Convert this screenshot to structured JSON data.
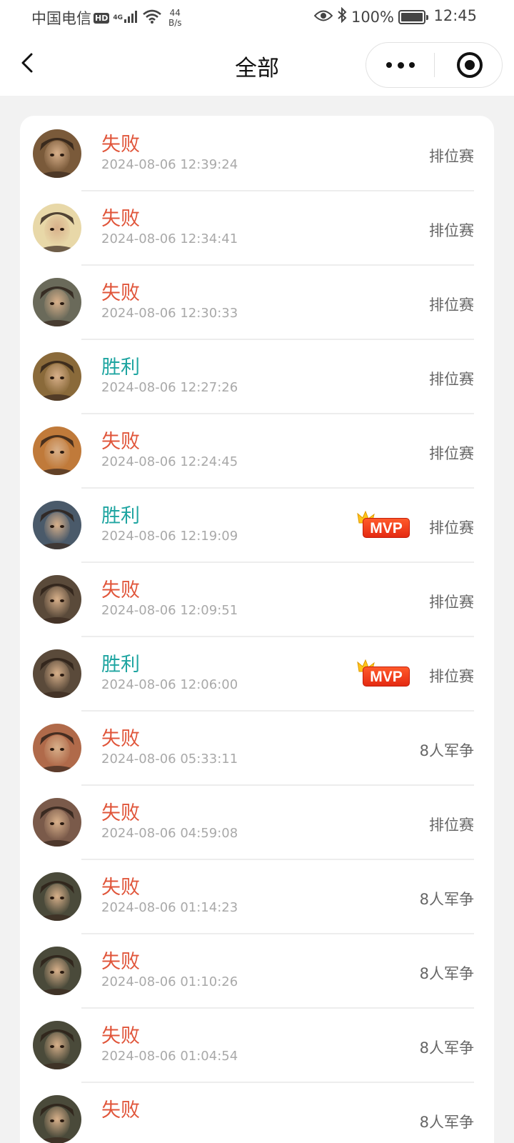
{
  "status_bar": {
    "carrier": "中国电信",
    "hd": "HD",
    "network": "4G",
    "speed_value": "44",
    "speed_unit": "B/s",
    "battery": "100%",
    "time": "12:45"
  },
  "nav": {
    "title": "全部"
  },
  "records": [
    {
      "result": "失败",
      "type": "lose",
      "time": "2024-08-06 12:39:24",
      "mode": "排位赛",
      "mvp": false,
      "avatar_color": "#7a5a3a"
    },
    {
      "result": "失败",
      "type": "lose",
      "time": "2024-08-06 12:34:41",
      "mode": "排位赛",
      "mvp": false,
      "avatar_color": "#e8d8a8"
    },
    {
      "result": "失败",
      "type": "lose",
      "time": "2024-08-06 12:30:33",
      "mode": "排位赛",
      "mvp": false,
      "avatar_color": "#6a6a5a"
    },
    {
      "result": "胜利",
      "type": "win",
      "time": "2024-08-06 12:27:26",
      "mode": "排位赛",
      "mvp": false,
      "avatar_color": "#8a6a3a"
    },
    {
      "result": "失败",
      "type": "lose",
      "time": "2024-08-06 12:24:45",
      "mode": "排位赛",
      "mvp": false,
      "avatar_color": "#c07a3a"
    },
    {
      "result": "胜利",
      "type": "win",
      "time": "2024-08-06 12:19:09",
      "mode": "排位赛",
      "mvp": true,
      "avatar_color": "#4a5a6a"
    },
    {
      "result": "失败",
      "type": "lose",
      "time": "2024-08-06 12:09:51",
      "mode": "排位赛",
      "mvp": false,
      "avatar_color": "#5a4a3a"
    },
    {
      "result": "胜利",
      "type": "win",
      "time": "2024-08-06 12:06:00",
      "mode": "排位赛",
      "mvp": true,
      "avatar_color": "#5a4a3a"
    },
    {
      "result": "失败",
      "type": "lose",
      "time": "2024-08-06 05:33:11",
      "mode": "8人军争",
      "mvp": false,
      "avatar_color": "#b06a4a"
    },
    {
      "result": "失败",
      "type": "lose",
      "time": "2024-08-06 04:59:08",
      "mode": "排位赛",
      "mvp": false,
      "avatar_color": "#7a5a4a"
    },
    {
      "result": "失败",
      "type": "lose",
      "time": "2024-08-06 01:14:23",
      "mode": "8人军争",
      "mvp": false,
      "avatar_color": "#4a4a3a"
    },
    {
      "result": "失败",
      "type": "lose",
      "time": "2024-08-06 01:10:26",
      "mode": "8人军争",
      "mvp": false,
      "avatar_color": "#4a4a3a"
    },
    {
      "result": "失败",
      "type": "lose",
      "time": "2024-08-06 01:04:54",
      "mode": "8人军争",
      "mvp": false,
      "avatar_color": "#4a4a3a"
    },
    {
      "result": "失败",
      "type": "lose",
      "time": "",
      "mode": "8人军争",
      "mvp": false,
      "avatar_color": "#4a4a3a"
    }
  ],
  "mvp_label": "MVP",
  "icons": {
    "back": "chevron-left-icon",
    "more": "more-dots-icon",
    "close": "record-circle-icon",
    "mvp": "mvp-crown-badge-icon"
  }
}
